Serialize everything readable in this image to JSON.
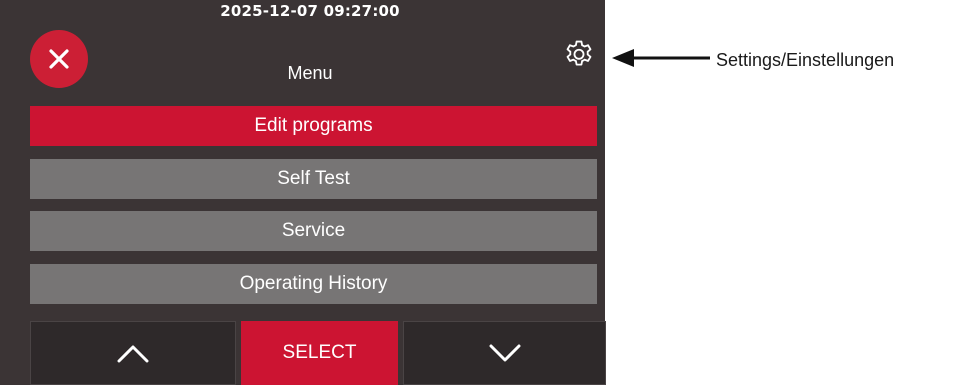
{
  "header": {
    "timestamp": "2025-12-07 09:27:00",
    "title": "Menu"
  },
  "icons": {
    "close": "close-icon",
    "settings": "gear-icon",
    "up": "chevron-up-icon",
    "down": "chevron-down-icon"
  },
  "menu": {
    "items": [
      {
        "label": "Edit programs",
        "selected": true
      },
      {
        "label": "Self Test",
        "selected": false
      },
      {
        "label": "Service",
        "selected": false
      },
      {
        "label": "Operating History",
        "selected": false
      }
    ]
  },
  "bottom_bar": {
    "select_label": "SELECT"
  },
  "annotation": {
    "label": "Settings/Einstellungen"
  },
  "colors": {
    "panel_background": "#3b3435",
    "accent_red": "#cc1432",
    "item_gray": "#777575"
  }
}
